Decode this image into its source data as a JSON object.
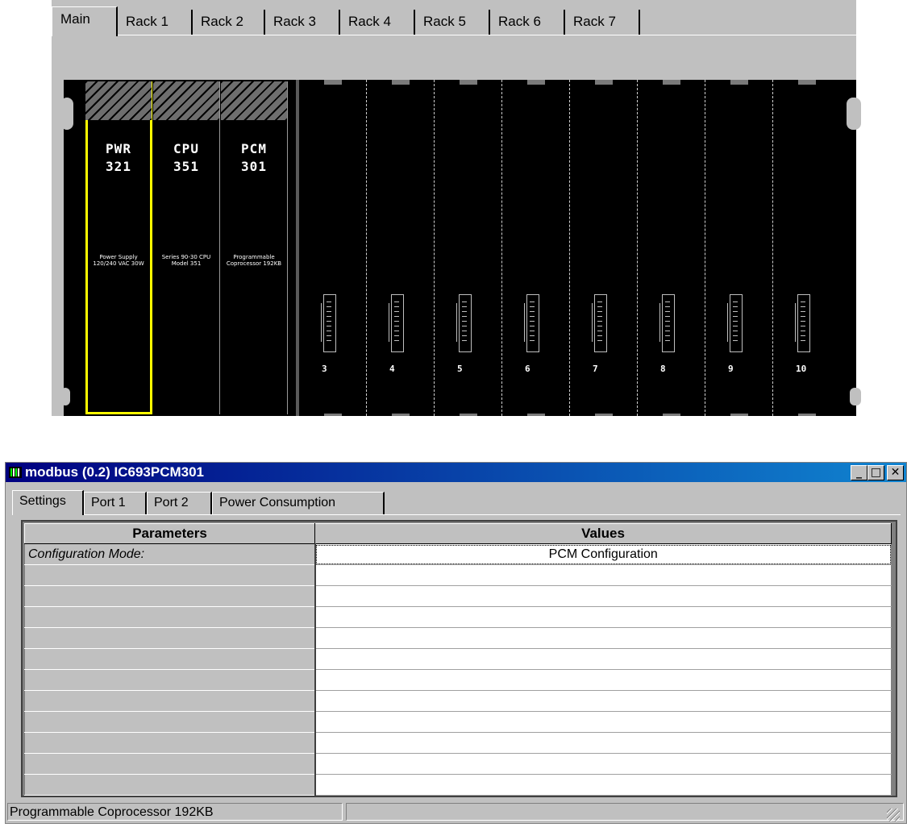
{
  "rack_view": {
    "tabs": [
      "Main",
      "Rack 1",
      "Rack 2",
      "Rack 3",
      "Rack 4",
      "Rack 5",
      "Rack 6",
      "Rack 7"
    ],
    "active_tab": "Main",
    "selection_color": "#ffff00",
    "modules": [
      {
        "name": "PWR",
        "number": "321",
        "description": "Power Supply 120/240 VAC 30W",
        "selected": true
      },
      {
        "name": "CPU",
        "number": "351",
        "description": "Series 90-30 CPU Model 351",
        "selected": false
      },
      {
        "name": "PCM",
        "number": "301",
        "description": "Programmable Coprocessor 192KB",
        "selected": false
      }
    ],
    "empty_slots": [
      "3",
      "4",
      "5",
      "6",
      "7",
      "8",
      "9",
      "10"
    ]
  },
  "properties_window": {
    "title": "modbus (0.2) IC693PCM301",
    "title_icon": "rack-icon",
    "buttons": {
      "minimize": "_",
      "maximize": "□",
      "close": "✕"
    },
    "tabs": [
      "Settings",
      "Port 1",
      "Port 2",
      "Power Consumption"
    ],
    "active_tab": "Settings",
    "grid": {
      "headers": {
        "parameters": "Parameters",
        "values": "Values"
      },
      "rows": [
        {
          "param": "Configuration Mode:",
          "value": "PCM Configuration"
        },
        {
          "param": "",
          "value": ""
        },
        {
          "param": "",
          "value": ""
        },
        {
          "param": "",
          "value": ""
        },
        {
          "param": "",
          "value": ""
        },
        {
          "param": "",
          "value": ""
        },
        {
          "param": "",
          "value": ""
        },
        {
          "param": "",
          "value": ""
        },
        {
          "param": "",
          "value": ""
        },
        {
          "param": "",
          "value": ""
        },
        {
          "param": "",
          "value": ""
        },
        {
          "param": "",
          "value": ""
        }
      ]
    },
    "status": "Programmable Coprocessor 192KB",
    "titlebar_colors": [
      "#000080",
      "#1084d0"
    ]
  }
}
